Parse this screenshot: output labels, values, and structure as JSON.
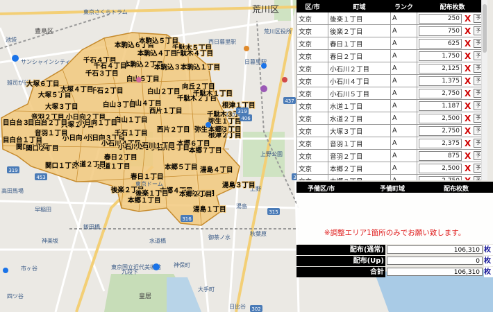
{
  "table": {
    "headers": {
      "ward": "区/市",
      "town": "町域",
      "rank": "ランク",
      "count": "配布枚数"
    },
    "rows": [
      {
        "ward": "文京",
        "town": "後楽１丁目",
        "rank": "A",
        "count": "250"
      },
      {
        "ward": "文京",
        "town": "後楽２丁目",
        "rank": "A",
        "count": "750"
      },
      {
        "ward": "文京",
        "town": "春日１丁目",
        "rank": "A",
        "count": "625"
      },
      {
        "ward": "文京",
        "town": "春日２丁目",
        "rank": "A",
        "count": "1,750"
      },
      {
        "ward": "文京",
        "town": "小石川２丁目",
        "rank": "A",
        "count": "2,125"
      },
      {
        "ward": "文京",
        "town": "小石川４丁目",
        "rank": "A",
        "count": "1,375"
      },
      {
        "ward": "文京",
        "town": "小石川５丁目",
        "rank": "A",
        "count": "2,750"
      },
      {
        "ward": "文京",
        "town": "水道１丁目",
        "rank": "A",
        "count": "1,187"
      },
      {
        "ward": "文京",
        "town": "水道２丁目",
        "rank": "A",
        "count": "2,500"
      },
      {
        "ward": "文京",
        "town": "大塚３丁目",
        "rank": "A",
        "count": "2,750"
      },
      {
        "ward": "文京",
        "town": "音羽１丁目",
        "rank": "A",
        "count": "2,375"
      },
      {
        "ward": "文京",
        "town": "音羽２丁目",
        "rank": "A",
        "count": "875"
      },
      {
        "ward": "文京",
        "town": "本郷２丁目",
        "rank": "A",
        "count": "2,500"
      },
      {
        "ward": "文京",
        "town": "本郷３丁目",
        "rank": "A",
        "count": "2,750"
      },
      {
        "ward": "文京",
        "town": "本郷４丁目",
        "rank": "A",
        "count": "2,375"
      }
    ],
    "delete_glyph": "X",
    "reserve_label": "予"
  },
  "reserve_header": {
    "ward": "予備区/市",
    "town": "予備町域",
    "count": "配布枚数"
  },
  "notice": "※調整エリア1箇所のみでお願い致します。",
  "totals": [
    {
      "label": "配布(通常)",
      "value": "106,310",
      "unit": "枚"
    },
    {
      "label": "配布(Up)",
      "value": "0",
      "unit": "枚"
    },
    {
      "label": "合計",
      "value": "106,310",
      "unit": "枚"
    }
  ],
  "map": {
    "region_labels": [
      "本駒込６丁目",
      "本駒込５丁目",
      "千駄木５丁目",
      "千石４丁目",
      "本駒込２丁目",
      "千駄木４丁目",
      "千石３丁目",
      "本駒込４丁目",
      "本駒込３丁目",
      "本駒込１丁目",
      "大塚６丁目",
      "大塚５丁目",
      "千石２丁目",
      "白山５丁目",
      "白山４丁目",
      "千駄木２丁目",
      "千駄木３丁目",
      "大塚４丁目",
      "白山３丁目",
      "白山２丁目",
      "向丘２丁目",
      "根津２丁目",
      "弥生２丁目",
      "音羽２丁目",
      "小日向２丁目",
      "大塚１丁目",
      "白山１丁目",
      "西片２丁目",
      "弥生１丁目",
      "目白台３丁目",
      "小日向４丁目",
      "小日向３丁目",
      "千石１丁目",
      "目白台１丁目",
      "関口３丁目",
      "小石川４丁目",
      "本郷６丁目",
      "関口２丁目",
      "小石川２丁目",
      "小石川３丁目",
      "春日２丁目",
      "本郷７丁目",
      "関口１丁目",
      "水道１丁目",
      "水道２丁目",
      "本郷５丁目",
      "湯島４丁目",
      "春日１丁目",
      "後楽２丁目",
      "本郷４丁目",
      "湯島３丁目",
      "後楽１丁目",
      "湯島１丁目",
      "湯島２丁目",
      "本郷２丁目",
      "本郷１丁目",
      "西片１丁目",
      "千駄木１丁目",
      "大塚３丁目",
      "音羽１丁目",
      "小日向１丁目",
      "小石川１丁目",
      "目白台２丁目",
      "本郷３丁目",
      "根津１丁目",
      "千石４丁目"
    ],
    "place_labels": [
      "東京さくらトラム",
      "荒川区",
      "荒川区役所",
      "東京都立文京",
      "東京ドーム",
      "日暮里駅",
      "西日暮里駅",
      "サンシャインシティ",
      "雑司が谷",
      "池袋",
      "高田馬場",
      "早稲田",
      "神楽坂",
      "飯田橋",
      "水道橋",
      "神保町",
      "九段下",
      "秋葉原",
      "上野",
      "御茶ノ水",
      "湯島",
      "大手町",
      "東京国立近代美術館",
      "皇居",
      "日比谷",
      "市ヶ谷",
      "四ツ谷",
      "豊島区",
      "上野公園"
    ],
    "road_numbers": [
      "319",
      "437",
      "306",
      "315",
      "302",
      "319",
      "453",
      "316",
      "406"
    ]
  }
}
